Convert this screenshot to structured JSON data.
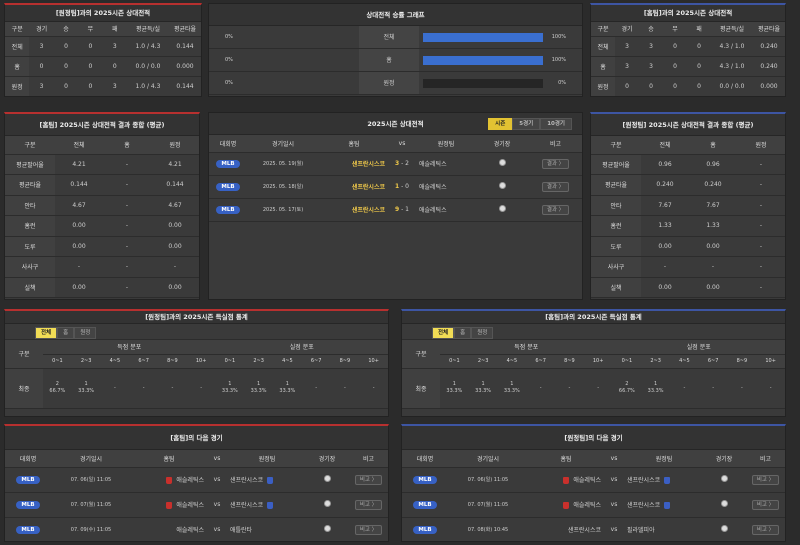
{
  "home_season": {
    "title": "[원정팀]과의 2025시즌 상대전적",
    "headers": [
      "구분",
      "경기",
      "승",
      "무",
      "패",
      "평균득/실",
      "평균타율"
    ],
    "rows": [
      [
        "전체",
        "3",
        "0",
        "0",
        "3",
        "1.0 / 4.3",
        "0.144"
      ],
      [
        "홈",
        "0",
        "0",
        "0",
        "0",
        "0.0 / 0.0",
        "0.000"
      ],
      [
        "원정",
        "3",
        "0",
        "0",
        "3",
        "1.0 / 4.3",
        "0.144"
      ]
    ]
  },
  "away_season": {
    "title": "[홈팀]과의 2025시즌 상대전적",
    "headers": [
      "구분",
      "경기",
      "승",
      "무",
      "패",
      "평균득/실",
      "평균타율"
    ],
    "rows": [
      [
        "전체",
        "3",
        "3",
        "0",
        "0",
        "4.3 / 1.0",
        "0.240"
      ],
      [
        "홈",
        "3",
        "3",
        "0",
        "0",
        "4.3 / 1.0",
        "0.240"
      ],
      [
        "원정",
        "0",
        "0",
        "0",
        "0",
        "0.0 / 0.0",
        "0.000"
      ]
    ]
  },
  "graph": {
    "title": "상대전적 승률 그래프",
    "rows": [
      {
        "left": "0%",
        "label": "전체",
        "right": "100%",
        "fill": 1.0
      },
      {
        "left": "0%",
        "label": "홈",
        "right": "100%",
        "fill": 1.0
      },
      {
        "left": "0%",
        "label": "원정",
        "right": "0%",
        "fill": 0.0
      }
    ]
  },
  "home_summary": {
    "title": "[홈팀] 2025시즌 상대전적 결과 종합 (평균)",
    "headers": [
      "구분",
      "전체",
      "홈",
      "원정"
    ],
    "rows": [
      [
        "평균팔어율",
        "4.21",
        "-",
        "4.21"
      ],
      [
        "평균타율",
        "0.144",
        "-",
        "0.144"
      ],
      [
        "안타",
        "4.67",
        "-",
        "4.67"
      ],
      [
        "홈런",
        "0.00",
        "-",
        "0.00"
      ],
      [
        "도루",
        "0.00",
        "-",
        "0.00"
      ],
      [
        "사사구",
        "-",
        "-",
        "-"
      ],
      [
        "실책",
        "0.00",
        "-",
        "0.00"
      ]
    ]
  },
  "away_summary": {
    "title": "[원정팀] 2025시즌 상대전적 결과 종합 (평균)",
    "headers": [
      "구분",
      "전체",
      "홈",
      "원정"
    ],
    "rows": [
      [
        "평균팔어율",
        "0.96",
        "0.96",
        "-"
      ],
      [
        "평균타율",
        "0.240",
        "0.240",
        "-"
      ],
      [
        "안타",
        "7.67",
        "7.67",
        "-"
      ],
      [
        "홈런",
        "1.33",
        "1.33",
        "-"
      ],
      [
        "도루",
        "0.00",
        "0.00",
        "-"
      ],
      [
        "사사구",
        "-",
        "-",
        "-"
      ],
      [
        "실책",
        "0.00",
        "0.00",
        "-"
      ]
    ]
  },
  "h2h": {
    "title": "2025시즌 상대전적",
    "tabs": [
      "시즌",
      "5경기",
      "10경기"
    ],
    "headers": [
      "대회명",
      "경기일시",
      "홈팀",
      "vs",
      "원정팀",
      "경기장",
      "비고"
    ],
    "games": [
      {
        "league": "MLB",
        "date": "2025. 05. 19(월)",
        "home": "샌프란시스코",
        "hs": "3",
        "as": "2",
        "away": "애슬레틱스",
        "note": "결과 〉"
      },
      {
        "league": "MLB",
        "date": "2025. 05. 18(일)",
        "home": "샌프란시스코",
        "hs": "1",
        "as": "0",
        "away": "애슬레틱스",
        "note": "결과 〉"
      },
      {
        "league": "MLB",
        "date": "2025. 05. 17(토)",
        "home": "샌프란시스코",
        "hs": "9",
        "as": "1",
        "away": "애슬레틱스",
        "note": "결과 〉"
      }
    ]
  },
  "left_score": {
    "title": "[원정팀]과의 2025시즌 득실점 통계",
    "tabs": [
      "전체",
      "홈",
      "원정"
    ],
    "group1": "득점 분포",
    "group2": "실점 분포",
    "row_header": "구분",
    "ranges": [
      "0~1",
      "2~3",
      "4~5",
      "6~7",
      "8~9",
      "10+"
    ],
    "row_label": "최종",
    "scored": [
      {
        "n": "2",
        "p": "66.7%"
      },
      {
        "n": "1",
        "p": "33.3%"
      },
      {
        "n": "-",
        "p": ""
      },
      {
        "n": "-",
        "p": ""
      },
      {
        "n": "-",
        "p": ""
      },
      {
        "n": "-",
        "p": ""
      }
    ],
    "allowed": [
      {
        "n": "1",
        "p": "33.3%"
      },
      {
        "n": "1",
        "p": "33.3%"
      },
      {
        "n": "1",
        "p": "33.3%"
      },
      {
        "n": "-",
        "p": ""
      },
      {
        "n": "-",
        "p": ""
      },
      {
        "n": "-",
        "p": ""
      }
    ]
  },
  "right_score": {
    "title": "[홈팀]과의 2025시즌 득실점 통계",
    "tabs": [
      "전체",
      "홈",
      "원정"
    ],
    "group1": "득점 분포",
    "group2": "실점 분포",
    "row_header": "구분",
    "ranges": [
      "0~1",
      "2~3",
      "4~5",
      "6~7",
      "8~9",
      "10+"
    ],
    "row_label": "최종",
    "scored": [
      {
        "n": "1",
        "p": "33.3%"
      },
      {
        "n": "1",
        "p": "33.3%"
      },
      {
        "n": "1",
        "p": "33.3%"
      },
      {
        "n": "-",
        "p": ""
      },
      {
        "n": "-",
        "p": ""
      },
      {
        "n": "-",
        "p": ""
      }
    ],
    "allowed": [
      {
        "n": "2",
        "p": "66.7%"
      },
      {
        "n": "1",
        "p": "33.3%"
      },
      {
        "n": "-",
        "p": ""
      },
      {
        "n": "-",
        "p": ""
      },
      {
        "n": "-",
        "p": ""
      },
      {
        "n": "-",
        "p": ""
      }
    ]
  },
  "left_next": {
    "title": "[홈팀]의 다음 경기",
    "headers": [
      "대회명",
      "경기일시",
      "홈팀",
      "vs",
      "원정팀",
      "경기장",
      "비고"
    ],
    "games": [
      {
        "league": "MLB",
        "date": "07. 06(일) 11:05",
        "home": "애슬레틱스",
        "away": "샌프란시스코",
        "hu": "red",
        "au": "blue",
        "note": "비고 〉"
      },
      {
        "league": "MLB",
        "date": "07. 07(월) 11:05",
        "home": "애슬레틱스",
        "away": "샌프란시스코",
        "hu": "red",
        "au": "blue",
        "note": "비고 〉"
      },
      {
        "league": "MLB",
        "date": "07. 09(수) 11:05",
        "home": "애슬레틱스",
        "away": "애틀란타",
        "hu": "",
        "au": "",
        "note": "비고 〉"
      }
    ]
  },
  "right_next": {
    "title": "[원정팀]의 다음 경기",
    "headers": [
      "대회명",
      "경기일시",
      "홈팀",
      "vs",
      "원정팀",
      "경기장",
      "비고"
    ],
    "games": [
      {
        "league": "MLB",
        "date": "07. 06(일) 11:05",
        "home": "애슬레틱스",
        "away": "샌프란시스코",
        "hu": "red",
        "au": "blue",
        "note": "비고 〉"
      },
      {
        "league": "MLB",
        "date": "07. 07(월) 11:05",
        "home": "애슬레틱스",
        "away": "샌프란시스코",
        "hu": "red",
        "au": "blue",
        "note": "비고 〉"
      },
      {
        "league": "MLB",
        "date": "07. 08(화) 10:45",
        "home": "샌프란시스코",
        "away": "필라델피아",
        "hu": "",
        "au": "",
        "note": "비고 〉"
      }
    ]
  }
}
